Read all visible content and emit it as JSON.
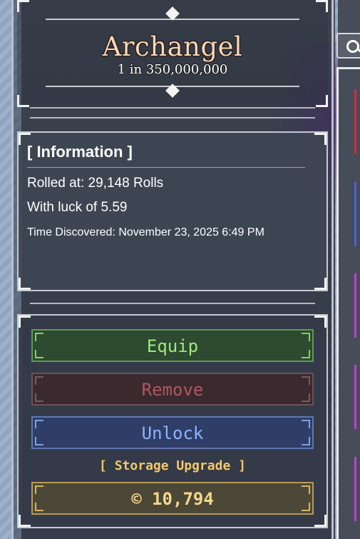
{
  "header": {
    "title": "Archangel",
    "rarity": "1 in 350,000,000"
  },
  "info": {
    "heading": "[ Information ]",
    "rolled_at": "Rolled at: 29,148 Rolls",
    "luck": "With luck of 5.59",
    "time_discovered": "Time Discovered: November 23, 2025 6:49 PM"
  },
  "actions": {
    "equip_label": "Equip",
    "remove_label": "Remove",
    "unlock_label": "Unlock",
    "storage_upgrade_label": "[ Storage Upgrade ]",
    "price": "© 10,794"
  },
  "colors": {
    "equip": "#9eea7c",
    "remove": "#b0565c",
    "unlock": "#8fb3ff",
    "storage": "#f3c86a",
    "title": "#f6d8b8"
  },
  "sidebar": {
    "search_icon": "search-icon",
    "item_colors": [
      "#d0303a",
      "#4a63d8",
      "#c040d0",
      "#c040d0",
      "#c040d0"
    ]
  }
}
